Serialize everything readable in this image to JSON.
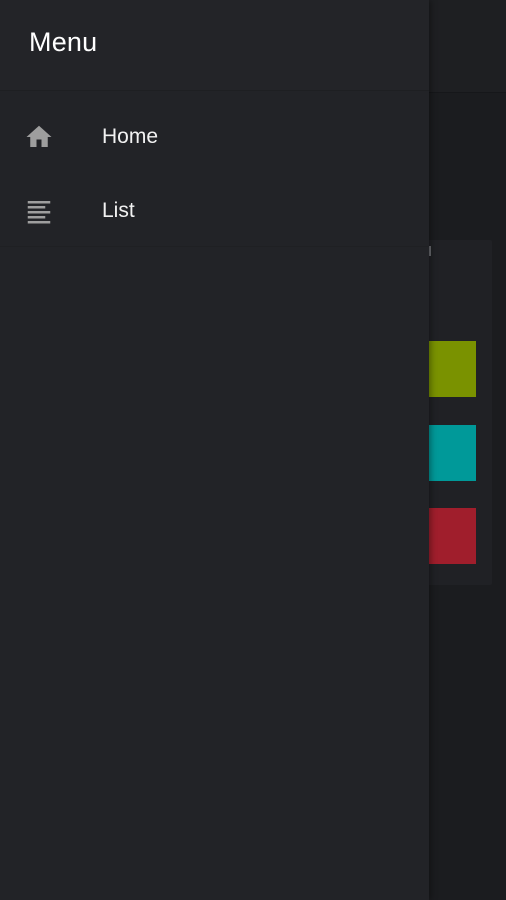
{
  "drawer": {
    "title": "Menu",
    "items": [
      {
        "label": "Home",
        "icon": "home-icon"
      },
      {
        "label": "List",
        "icon": "list-icon"
      }
    ]
  },
  "background": {
    "swatches": [
      {
        "color": "#7a9200"
      },
      {
        "color": "#009999"
      },
      {
        "color": "#a01e2c"
      }
    ]
  },
  "colors": {
    "drawer_bg": "#222327",
    "screen_bg": "#1b1c1f",
    "icon": "#9e9e9e",
    "text": "#ffffff"
  }
}
